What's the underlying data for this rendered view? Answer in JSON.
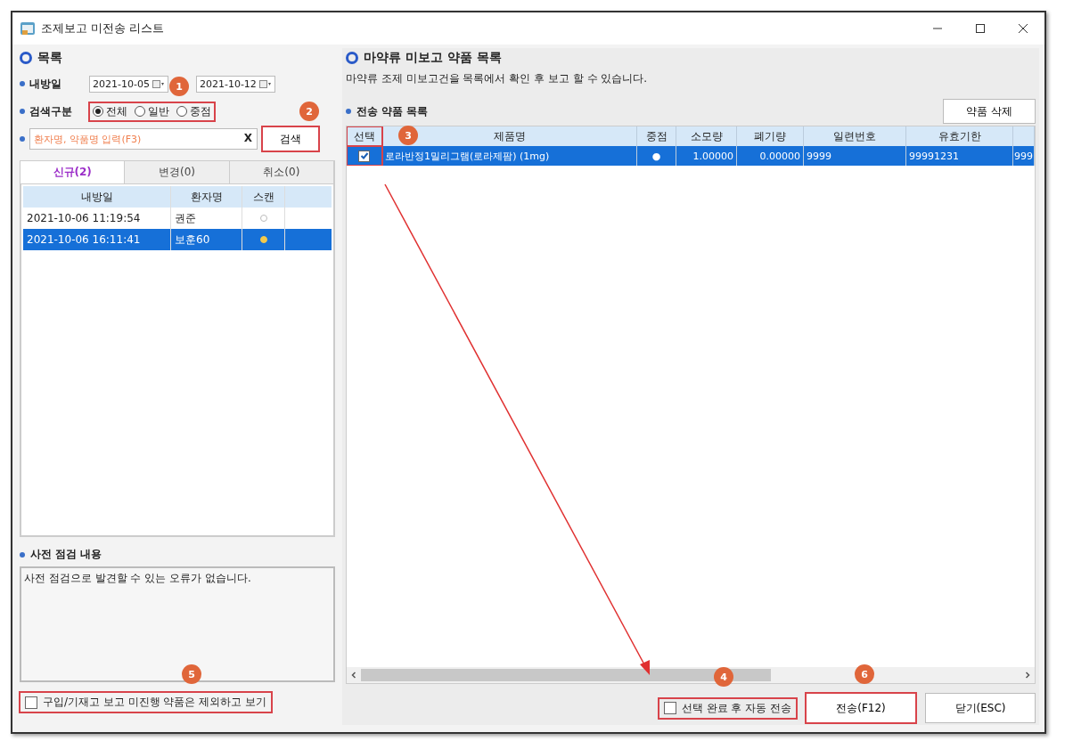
{
  "window": {
    "title": "조제보고 미전송 리스트"
  },
  "left": {
    "heading": "목록",
    "date_label": "내방일",
    "date_from": "2021-10-05",
    "date_to": "2021-10-12",
    "type_label": "검색구분",
    "type_options": [
      {
        "label": "전체",
        "selected": true
      },
      {
        "label": "일반",
        "selected": false
      },
      {
        "label": "중점",
        "selected": false
      }
    ],
    "type_highlighted": true,
    "search": {
      "placeholder": "환자명, 약품명 입력(F3)",
      "clear": "X",
      "button": "검색",
      "button_highlighted": true
    },
    "tabs": [
      {
        "label": "신규(2)",
        "selected": true
      },
      {
        "label": "변경(0)",
        "selected": false
      },
      {
        "label": "취소(0)",
        "selected": false
      }
    ],
    "table": {
      "columns": [
        "내방일",
        "환자명",
        "스캔"
      ],
      "rows": [
        {
          "visit": "2021-10-06 11:19:54",
          "patient": "권준",
          "scanned": false,
          "selected": false
        },
        {
          "visit": "2021-10-06 16:11:41",
          "patient": "보훈60",
          "scanned": true,
          "selected": true
        }
      ]
    },
    "check_heading": "사전 점검 내용",
    "check_text": "사전 점검으로 발견할 수 있는 오류가 없습니다.",
    "exclude": {
      "label": "구입/기재고 보고 미진행 약품은 제외하고 보기",
      "checked": false,
      "highlighted": true
    }
  },
  "right": {
    "heading": "마약류 미보고 약품 목록",
    "description": "마약류 조제 미보고건을 목록에서 확인 후 보고 할 수 있습니다.",
    "sub_heading": "전송 약품 목록",
    "delete_button": "약품 삭제",
    "table": {
      "columns": [
        "선택",
        "제품명",
        "중점",
        "소모량",
        "폐기량",
        "일련번호",
        "유효기한"
      ],
      "select_highlighted": true,
      "rows": [
        {
          "checked": true,
          "selected": true,
          "name": "로라반정1밀리그램(로라제팜) (1mg)",
          "focus": "●",
          "used": "1.00000",
          "waste": "0.00000",
          "serial": "9999",
          "expiry": "99991231",
          "column_8": "999"
        }
      ]
    },
    "auto_send": {
      "label": "선택 완료 후 자동 전송",
      "checked": false,
      "highlighted": true
    },
    "send_button": {
      "label": "전송(F12)",
      "highlighted": true
    },
    "close_button": {
      "label": "닫기(ESC)"
    }
  },
  "callouts": [
    {
      "label": "1"
    },
    {
      "label": "2"
    },
    {
      "label": "3"
    },
    {
      "label": "5"
    },
    {
      "label": "4"
    },
    {
      "label": "6"
    }
  ]
}
